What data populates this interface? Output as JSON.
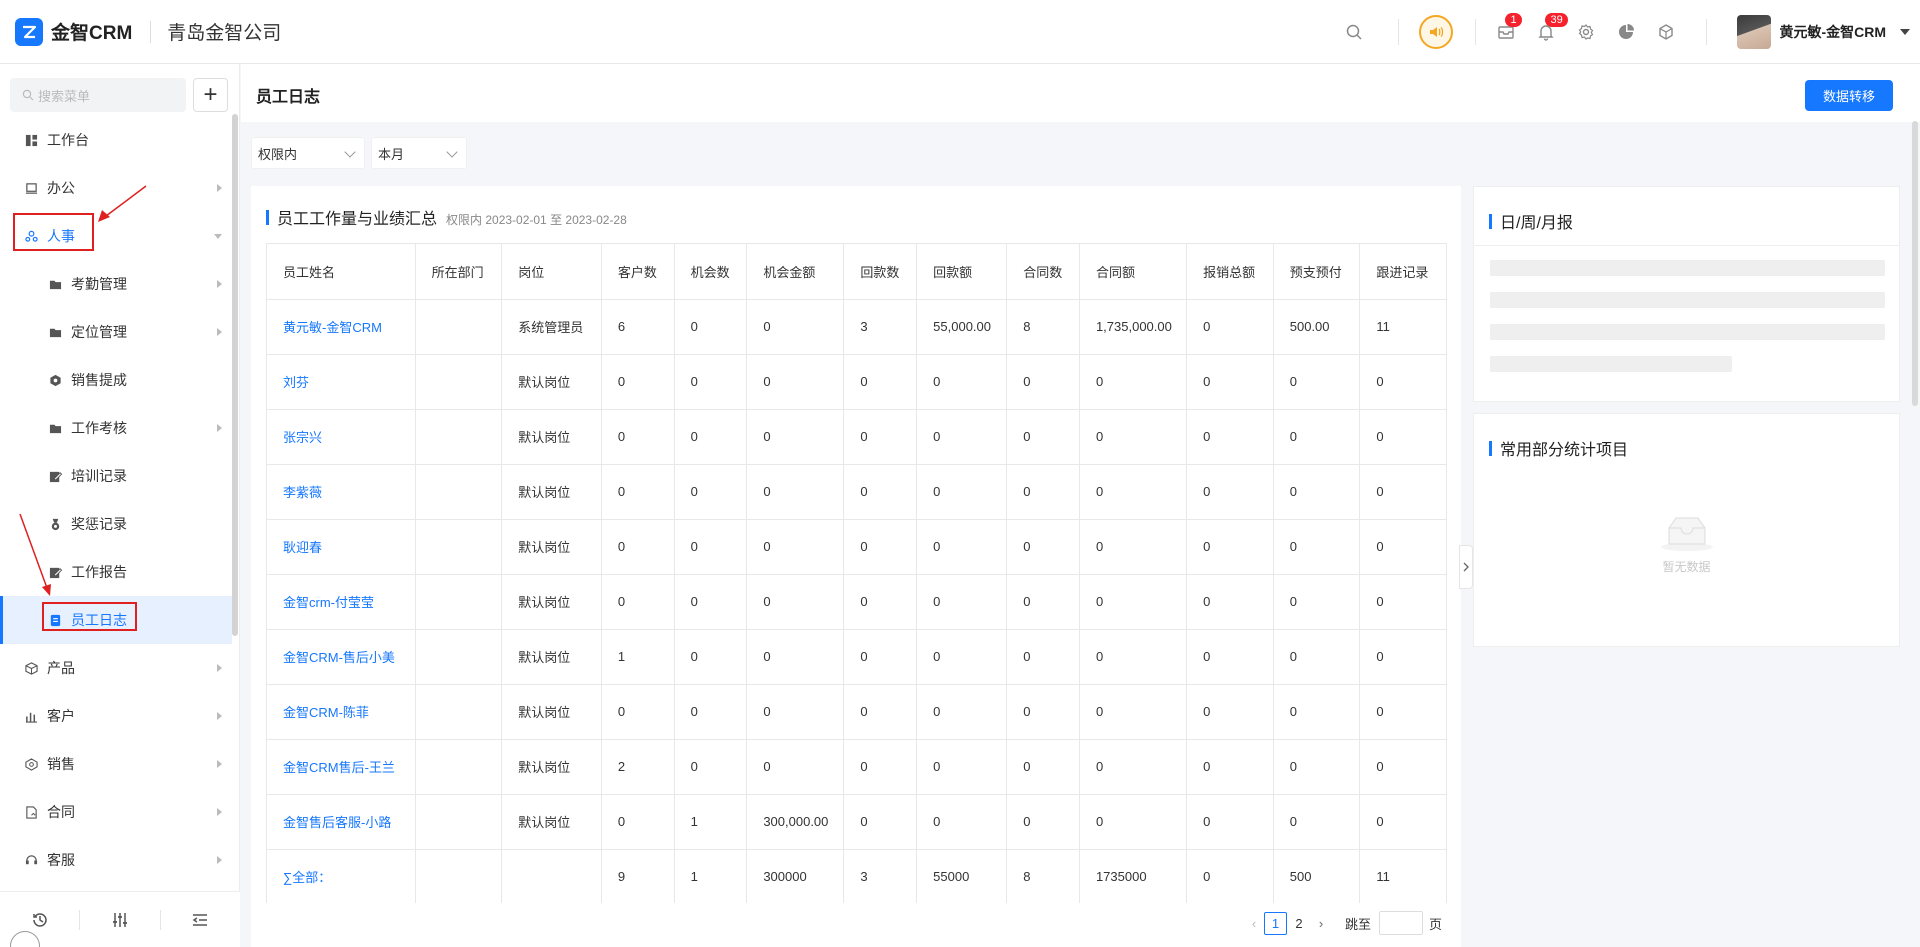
{
  "app": {
    "logo_text": "金智CRM",
    "company": "青岛金智公司",
    "user_name": "黄元敏-金智CRM",
    "mail_badge": "1",
    "notice_badge": "39",
    "accent": "#1677ff"
  },
  "sidebar": {
    "search_placeholder": "搜索菜单",
    "add_label": "+",
    "items": [
      {
        "label": "工作台",
        "icon": "dashboard-icon"
      },
      {
        "label": "办公",
        "icon": "office-icon"
      },
      {
        "label": "人事",
        "icon": "hr-icon"
      },
      {
        "label": "考勤管理",
        "icon": "folder-icon"
      },
      {
        "label": "定位管理",
        "icon": "folder-icon"
      },
      {
        "label": "销售提成",
        "icon": "commission-icon"
      },
      {
        "label": "工作考核",
        "icon": "folder-icon"
      },
      {
        "label": "培训记录",
        "icon": "edit-icon"
      },
      {
        "label": "奖惩记录",
        "icon": "medal-icon"
      },
      {
        "label": "工作报告",
        "icon": "edit-icon"
      },
      {
        "label": "员工日志",
        "icon": "log-icon"
      },
      {
        "label": "产品",
        "icon": "product-icon"
      },
      {
        "label": "客户",
        "icon": "customer-icon"
      },
      {
        "label": "销售",
        "icon": "sales-icon"
      },
      {
        "label": "合同",
        "icon": "contract-icon"
      },
      {
        "label": "客服",
        "icon": "service-icon"
      }
    ]
  },
  "page": {
    "title": "员工日志",
    "transfer_button": "数据转移",
    "filter_scope": "权限内",
    "filter_period": "本月"
  },
  "summary": {
    "title": "员工工作量与业绩汇总",
    "subtitle": "权限内 2023-02-01 至 2023-02-28",
    "columns": [
      "员工姓名",
      "所在部门",
      "岗位",
      "客户数",
      "机会数",
      "机会金额",
      "回款数",
      "回款额",
      "合同数",
      "合同额",
      "报销总额",
      "预支预付",
      "跟进记录"
    ],
    "rows": [
      [
        "黄元敏-金智CRM",
        "",
        "系统管理员",
        "6",
        "0",
        "0",
        "3",
        "55,000.00",
        "8",
        "1,735,000.00",
        "0",
        "500.00",
        "11"
      ],
      [
        "刘芬",
        "",
        "默认岗位",
        "0",
        "0",
        "0",
        "0",
        "0",
        "0",
        "0",
        "0",
        "0",
        "0"
      ],
      [
        "张宗兴",
        "",
        "默认岗位",
        "0",
        "0",
        "0",
        "0",
        "0",
        "0",
        "0",
        "0",
        "0",
        "0"
      ],
      [
        "李紫薇",
        "",
        "默认岗位",
        "0",
        "0",
        "0",
        "0",
        "0",
        "0",
        "0",
        "0",
        "0",
        "0"
      ],
      [
        "耿迎春",
        "",
        "默认岗位",
        "0",
        "0",
        "0",
        "0",
        "0",
        "0",
        "0",
        "0",
        "0",
        "0"
      ],
      [
        "金智crm-付莹莹",
        "",
        "默认岗位",
        "0",
        "0",
        "0",
        "0",
        "0",
        "0",
        "0",
        "0",
        "0",
        "0"
      ],
      [
        "金智CRM-售后小美",
        "",
        "默认岗位",
        "1",
        "0",
        "0",
        "0",
        "0",
        "0",
        "0",
        "0",
        "0",
        "0"
      ],
      [
        "金智CRM-陈菲",
        "",
        "默认岗位",
        "0",
        "0",
        "0",
        "0",
        "0",
        "0",
        "0",
        "0",
        "0",
        "0"
      ],
      [
        "金智CRM售后-王兰",
        "",
        "默认岗位",
        "2",
        "0",
        "0",
        "0",
        "0",
        "0",
        "0",
        "0",
        "0",
        "0"
      ],
      [
        "金智售后客服-小路",
        "",
        "默认岗位",
        "0",
        "1",
        "300,000.00",
        "0",
        "0",
        "0",
        "0",
        "0",
        "0",
        "0"
      ],
      [
        "∑全部：",
        "",
        "",
        "9",
        "1",
        "300000",
        "3",
        "55000",
        "8",
        "1735000",
        "0",
        "500",
        "11"
      ]
    ]
  },
  "pagination": {
    "pages": [
      "1",
      "2"
    ],
    "jump_label": "跳至",
    "page_suffix": "页"
  },
  "right_panels": {
    "report_title": "日/周/月报",
    "stats_title": "常用部分统计项目",
    "empty_text": "暂无数据"
  }
}
